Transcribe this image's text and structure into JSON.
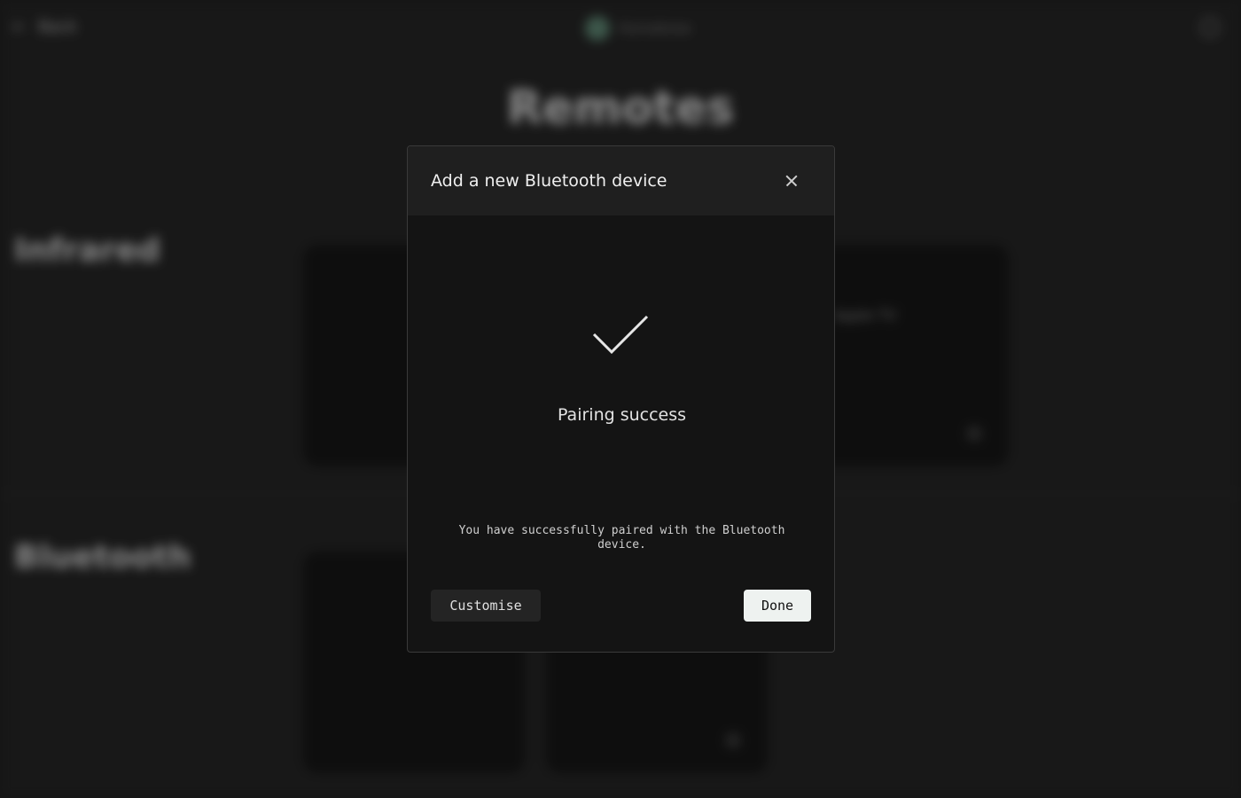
{
  "app": {
    "back_label": "Back",
    "brand_name": "Homebrew",
    "page_title": "Remotes"
  },
  "sections": [
    {
      "title": "Infrared",
      "subtitle": "· · · ·",
      "card_labels": [
        "",
        "Apple TV"
      ]
    },
    {
      "title": "Bluetooth",
      "subtitle": "· · · ·",
      "card_labels": [
        "",
        ""
      ]
    }
  ],
  "modal": {
    "title": "Add a new Bluetooth device",
    "status_icon": "checkmark-icon",
    "status_title": "Pairing success",
    "message": "You have successfully paired with the Bluetooth device.",
    "secondary_button": "Customise",
    "primary_button": "Done"
  },
  "colors": {
    "modal_bg": "#141414",
    "header_bg": "#1f1f1f",
    "primary_button_bg": "#eef2f0",
    "accent_brand": "#5f8f78"
  }
}
